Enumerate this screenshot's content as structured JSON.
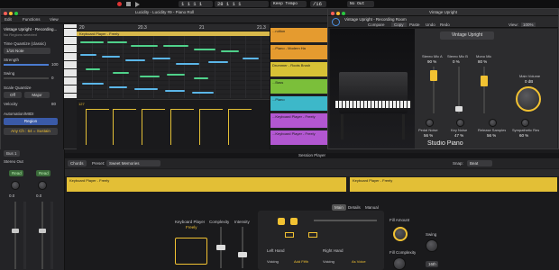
{
  "transport": {
    "bars_beats": "1 1 1 1",
    "position": "28 1 1 1",
    "project_name": "Lucidity - Lucidity #9 - Piano Roll",
    "keep_tempo": "Keep Tempo",
    "time_signature": "/16",
    "no_out": "No Out"
  },
  "piano_roll": {
    "title": "Lucidity - Lucidity #9 - Piano Roll",
    "edit_menu": "Edit",
    "functions_menu": "Functions",
    "view_menu": "View",
    "region_name": "Vintage Upright - Recording...",
    "region_sub": "No Regions selected",
    "time_quantize_label": "Time Quantize (classic)",
    "time_quantize_value": "1/16 Note",
    "strength_label": "Strength",
    "strength_value": "100",
    "swing_label": "Swing",
    "swing_value": "0",
    "scale_quantize_label": "Scale Quantize",
    "scale_off": "Off",
    "scale_major": "Major",
    "velocity_label": "Velocity",
    "velocity_value": "80",
    "automation_label": "Automation/MIDI",
    "region_button": "Region",
    "midi_channel": "Any Ch : 64 = Sustain",
    "ruler": [
      "20",
      "20.3",
      "21",
      "21.3",
      "22"
    ],
    "region_label": "Keyboard Player - Freely",
    "controller_value": "127"
  },
  "tracks": {
    "rows": [
      {
        "label": "...ruition",
        "color": "#e59b2f"
      },
      {
        "label": "...Piano - Modern Ha",
        "color": "#e59b2f"
      },
      {
        "label": "Drummer - Roots Brush",
        "color": "#d8c236"
      },
      {
        "label": "...Bass",
        "color": "#7bbf3a"
      },
      {
        "label": "...Piano",
        "color": "#3db8c9"
      },
      {
        "label": "...Keyboard Player - Freely",
        "color": "#b257d1"
      },
      {
        "label": "...Keyboard Player - Freely",
        "color": "#b257d1"
      }
    ]
  },
  "instrument": {
    "window_title": "Vintage Upright",
    "plugin_header": "Vintage Upright - Recording Room",
    "tabs": [
      "Compare",
      "Copy",
      "Paste",
      "Undo",
      "Redo"
    ],
    "view_label": "View:",
    "view_value": "100%",
    "preset": "Vintage Upright",
    "mic_labels": [
      "Stereo Mic A",
      "Stereo Mic B",
      "Mono Mic"
    ],
    "mic_values": [
      "90 %",
      "0 %",
      "80 %"
    ],
    "main_volume_label": "Main Volume",
    "main_volume_value": "0 dB",
    "bottom_labels": [
      "Pedal Noise",
      "Key Noise",
      "Release Samples",
      "Sympathetic Res"
    ],
    "bottom_values": [
      "56 %",
      "47 %",
      "56 %",
      "60 %"
    ],
    "studio_title": "Studio Piano"
  },
  "left_strip": {
    "bus_label": "Bus 1",
    "stereo_out": "Stereo Out",
    "read_labels": [
      "Read",
      "Read"
    ],
    "values": [
      "0.0",
      "0.0"
    ]
  },
  "session_player": {
    "title": "Session Player",
    "chords_label": "Chords",
    "preset_label": "Preset:",
    "preset_value": "Sweet Memories",
    "snap_label": "Snap:",
    "snap_value": "Beat",
    "region_left": "Keyboard Player - Freely",
    "region_right": "Keyboard Player - Freely",
    "player_label": "Keyboard Player",
    "player_value": "Freely",
    "complexity_label": "Complexity",
    "intensity_label": "Intensity",
    "tabs": [
      "Main",
      "Details",
      "Manual"
    ],
    "left_hand": "Left Hand",
    "right_hand": "Right Hand",
    "voicing_label": "Voicing",
    "voicing_left": "Add Fifth",
    "voicing_right": "As Voice",
    "fill_amount_label": "Fill Amount",
    "fill_complexity_label": "Fill Complexity",
    "swing_label": "Swing",
    "swing_value": "16th"
  }
}
